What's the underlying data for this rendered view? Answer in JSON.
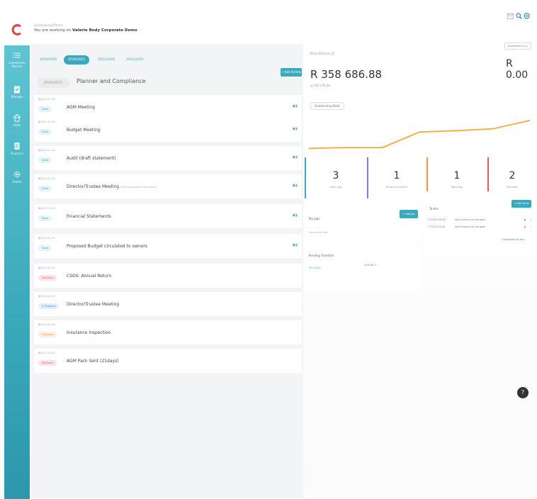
{
  "header": {
    "line1": "Bookkeeping Pitmoe",
    "prefix": "You are working on",
    "body_name": "Valerie Body Corporate Demo"
  },
  "top_icons": [
    "mail-icon",
    "search-icon",
    "settings-icon"
  ],
  "sidebar": {
    "items": [
      {
        "label": "Community Planner",
        "icon": "list-icon"
      },
      {
        "label": "Manage",
        "icon": "clipboard-icon"
      },
      {
        "label": "Units",
        "icon": "home-icon"
      },
      {
        "label": "Finances",
        "icon": "document-icon"
      },
      {
        "label": "Admin",
        "icon": "gear-icon"
      }
    ]
  },
  "planner": {
    "year_tabs": [
      "2019/2020",
      "2020/2021",
      "2021/2022",
      "2022/2023"
    ],
    "active_year": "2020/2021",
    "pill": "2020/2021",
    "title": "Planner and Compliance",
    "add_button": "+ Add Activity",
    "rows": [
      {
        "date": "2021-01-15",
        "status": "Done",
        "status_type": "done",
        "title": "AGM Meeting",
        "sub": ""
      },
      {
        "date": "2021-11-09",
        "status": "Done",
        "status_type": "done",
        "title": "Budget Meeting",
        "sub": ""
      },
      {
        "date": "2021-01-21",
        "status": "Done",
        "status_type": "done",
        "title": "Audit (draft statement)",
        "sub": ""
      },
      {
        "date": "2021-01-15",
        "status": "Done",
        "status_type": "done",
        "title": "Director/Trustee Meeting",
        "sub": "Fire Extinguisher Inspections"
      },
      {
        "date": "2021-01-28",
        "status": "Done",
        "status_type": "done",
        "title": "Financial Statements",
        "sub": ""
      },
      {
        "date": "2021-02-20",
        "status": "Done",
        "status_type": "done",
        "title": "Proposed Budget circulated to owners",
        "sub": ""
      },
      {
        "date": "2021-02-20",
        "status": "Not Done",
        "status_type": "notdone",
        "title": "CSOS: Annual Return",
        "sub": ""
      },
      {
        "date": "2021-02-20",
        "status": "In Progress",
        "status_type": "inprog",
        "title": "Director/Trustee Meeting",
        "sub": ""
      },
      {
        "date": "2021-02-28",
        "status": "Proposed",
        "status_type": "proposed",
        "title": "Insurance Inspection",
        "sub": ""
      },
      {
        "date": "2021-04-30",
        "status": "Not Done",
        "status_type": "notdone",
        "title": "AGM Pack Sent (21days)",
        "sub": ""
      }
    ]
  },
  "bank": {
    "label": "Bank Balance (2)",
    "value": "R 358 686.88",
    "date": "2021-05-10",
    "outstanding_debt": "Outstanding Debt"
  },
  "investments": {
    "button": "Investments (1)",
    "value": "R 0.00",
    "sub": "2–"
  },
  "chart_data": {
    "type": "line",
    "x": [
      1,
      2,
      3,
      4,
      5,
      6,
      7
    ],
    "values": [
      0.1,
      0.12,
      0.12,
      0.45,
      0.48,
      0.52,
      0.7
    ],
    "ylim": [
      0,
      1
    ],
    "color": "#f0b24a"
  },
  "stats": [
    {
      "value": "3",
      "label": "Open Jobs",
      "color": "#3aa9bb"
    },
    {
      "value": "1",
      "label": "Pending Transfers",
      "color": "#a06bd6"
    },
    {
      "value": "1",
      "label": "Warnings",
      "color": "#f0924a"
    },
    {
      "value": "2",
      "label": "Penalties",
      "color": "#e05a5a"
    }
  ],
  "my_jobs": {
    "title": "My jobs",
    "add_button": "+ Add Job",
    "empty": "No current jobs"
  },
  "pending_transfers": {
    "title": "Pending Transfers",
    "ref": "TF-17202",
    "unit": "Unit No. 5"
  },
  "todos": {
    "title": "To-dos",
    "add_button": "+ Add To-do",
    "items": [
      {
        "date": "2021-05-20",
        "text": "Send money on the gate"
      },
      {
        "date": "2021-04-28",
        "text": "Send money on the gate"
      }
    ],
    "completed_link": "Completed To-do's"
  },
  "help_icon": "?"
}
